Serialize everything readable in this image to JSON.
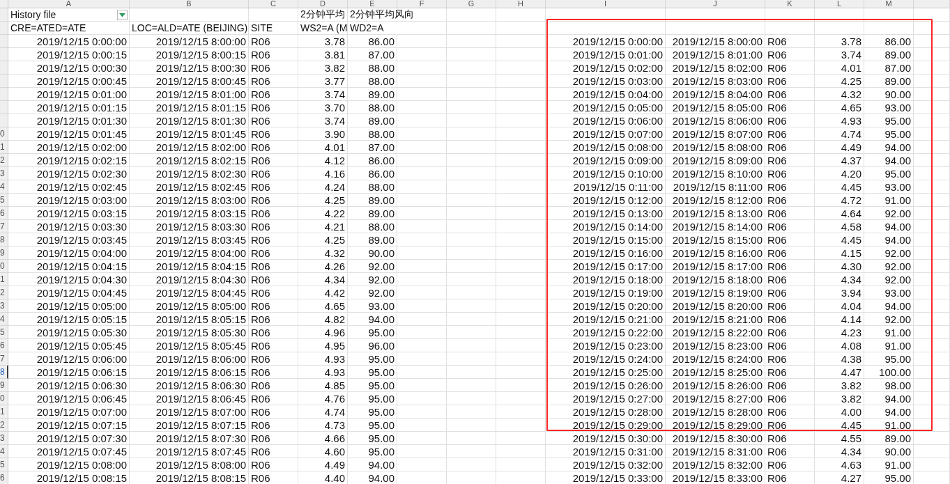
{
  "column_headers": [
    "A",
    "B",
    "C",
    "D",
    "E",
    "F",
    "G",
    "H",
    "I",
    "J",
    "K",
    "L",
    "M"
  ],
  "rows": [
    {
      "kind": "header",
      "selected": false,
      "highlighted": false,
      "filter": true,
      "cells": {
        "A": "History file",
        "D": "2分钟平均",
        "E": "2分钟平均风向"
      }
    },
    {
      "kind": "header",
      "selected": false,
      "highlighted": true,
      "cells": {
        "A": "CRE=ATED=ATE",
        "B": "LOC=ALD=ATE (BEIJING)",
        "C": "SITE",
        "D": "WS2=A (M",
        "E": "WD2=A"
      }
    },
    {
      "kind": "data",
      "selected": false,
      "highlighted": true,
      "cells": {
        "A": "2019/12/15 0:00:00",
        "B": "2019/12/15 8:00:00",
        "C": "R06",
        "D": "3.78",
        "E": "86.00",
        "I": "2019/12/15 0:00:00",
        "J": "2019/12/15 8:00:00",
        "K": "R06",
        "L": "3.78",
        "M": "86.00"
      }
    },
    {
      "kind": "data",
      "selected": false,
      "highlighted": true,
      "cells": {
        "A": "2019/12/15 0:00:15",
        "B": "2019/12/15 8:00:15",
        "C": "R06",
        "D": "3.81",
        "E": "87.00",
        "I": "2019/12/15 0:01:00",
        "J": "2019/12/15 8:01:00",
        "K": "R06",
        "L": "3.74",
        "M": "89.00"
      }
    },
    {
      "kind": "data",
      "selected": false,
      "highlighted": true,
      "cells": {
        "A": "2019/12/15 0:00:30",
        "B": "2019/12/15 8:00:30",
        "C": "R06",
        "D": "3.82",
        "E": "88.00",
        "I": "2019/12/15 0:02:00",
        "J": "2019/12/15 8:02:00",
        "K": "R06",
        "L": "4.01",
        "M": "87.00"
      }
    },
    {
      "kind": "data",
      "selected": false,
      "highlighted": true,
      "cells": {
        "A": "2019/12/15 0:00:45",
        "B": "2019/12/15 8:00:45",
        "C": "R06",
        "D": "3.77",
        "E": "88.00",
        "I": "2019/12/15 0:03:00",
        "J": "2019/12/15 8:03:00",
        "K": "R06",
        "L": "4.25",
        "M": "89.00"
      }
    },
    {
      "kind": "data",
      "selected": false,
      "highlighted": true,
      "cells": {
        "A": "2019/12/15 0:01:00",
        "B": "2019/12/15 8:01:00",
        "C": "R06",
        "D": "3.74",
        "E": "89.00",
        "I": "2019/12/15 0:04:00",
        "J": "2019/12/15 8:04:00",
        "K": "R06",
        "L": "4.32",
        "M": "90.00"
      }
    },
    {
      "kind": "data",
      "selected": false,
      "highlighted": true,
      "cells": {
        "A": "2019/12/15 0:01:15",
        "B": "2019/12/15 8:01:15",
        "C": "R06",
        "D": "3.70",
        "E": "88.00",
        "I": "2019/12/15 0:05:00",
        "J": "2019/12/15 8:05:00",
        "K": "R06",
        "L": "4.65",
        "M": "93.00"
      }
    },
    {
      "kind": "data",
      "selected": false,
      "highlighted": true,
      "cells": {
        "A": "2019/12/15 0:01:30",
        "B": "2019/12/15 8:01:30",
        "C": "R06",
        "D": "3.74",
        "E": "89.00",
        "I": "2019/12/15 0:06:00",
        "J": "2019/12/15 8:06:00",
        "K": "R06",
        "L": "4.93",
        "M": "95.00"
      }
    },
    {
      "kind": "data",
      "row_number": "0",
      "selected": false,
      "highlighted": true,
      "cells": {
        "A": "2019/12/15 0:01:45",
        "B": "2019/12/15 8:01:45",
        "C": "R06",
        "D": "3.90",
        "E": "88.00",
        "I": "2019/12/15 0:07:00",
        "J": "2019/12/15 8:07:00",
        "K": "R06",
        "L": "4.74",
        "M": "95.00"
      }
    },
    {
      "kind": "data",
      "row_number": "1",
      "selected": false,
      "highlighted": true,
      "cells": {
        "A": "2019/12/15 0:02:00",
        "B": "2019/12/15 8:02:00",
        "C": "R06",
        "D": "4.01",
        "E": "87.00",
        "I": "2019/12/15 0:08:00",
        "J": "2019/12/15 8:08:00",
        "K": "R06",
        "L": "4.49",
        "M": "94.00"
      }
    },
    {
      "kind": "data",
      "row_number": "2",
      "selected": false,
      "highlighted": true,
      "cells": {
        "A": "2019/12/15 0:02:15",
        "B": "2019/12/15 8:02:15",
        "C": "R06",
        "D": "4.12",
        "E": "86.00",
        "I": "2019/12/15 0:09:00",
        "J": "2019/12/15 8:09:00",
        "K": "R06",
        "L": "4.37",
        "M": "94.00"
      }
    },
    {
      "kind": "data",
      "row_number": "3",
      "selected": false,
      "highlighted": true,
      "cells": {
        "A": "2019/12/15 0:02:30",
        "B": "2019/12/15 8:02:30",
        "C": "R06",
        "D": "4.16",
        "E": "86.00",
        "I": "2019/12/15 0:10:00",
        "J": "2019/12/15 8:10:00",
        "K": "R06",
        "L": "4.20",
        "M": "95.00"
      }
    },
    {
      "kind": "data",
      "row_number": "4",
      "selected": false,
      "highlighted": true,
      "cells": {
        "A": "2019/12/15 0:02:45",
        "B": "2019/12/15 8:02:45",
        "C": "R06",
        "D": "4.24",
        "E": "88.00",
        "I": "2019/12/15 0:11:00",
        "J": "2019/12/15 8:11:00",
        "K": "R06",
        "L": "4.45",
        "M": "93.00"
      }
    },
    {
      "kind": "data",
      "row_number": "5",
      "selected": false,
      "highlighted": true,
      "cells": {
        "A": "2019/12/15 0:03:00",
        "B": "2019/12/15 8:03:00",
        "C": "R06",
        "D": "4.25",
        "E": "89.00",
        "I": "2019/12/15 0:12:00",
        "J": "2019/12/15 8:12:00",
        "K": "R06",
        "L": "4.72",
        "M": "91.00"
      }
    },
    {
      "kind": "data",
      "row_number": "6",
      "selected": false,
      "highlighted": true,
      "cells": {
        "A": "2019/12/15 0:03:15",
        "B": "2019/12/15 8:03:15",
        "C": "R06",
        "D": "4.22",
        "E": "89.00",
        "I": "2019/12/15 0:13:00",
        "J": "2019/12/15 8:13:00",
        "K": "R06",
        "L": "4.64",
        "M": "92.00"
      }
    },
    {
      "kind": "data",
      "row_number": "7",
      "selected": false,
      "highlighted": true,
      "cells": {
        "A": "2019/12/15 0:03:30",
        "B": "2019/12/15 8:03:30",
        "C": "R06",
        "D": "4.21",
        "E": "88.00",
        "I": "2019/12/15 0:14:00",
        "J": "2019/12/15 8:14:00",
        "K": "R06",
        "L": "4.58",
        "M": "94.00"
      }
    },
    {
      "kind": "data",
      "row_number": "8",
      "selected": false,
      "highlighted": true,
      "cells": {
        "A": "2019/12/15 0:03:45",
        "B": "2019/12/15 8:03:45",
        "C": "R06",
        "D": "4.25",
        "E": "89.00",
        "I": "2019/12/15 0:15:00",
        "J": "2019/12/15 8:15:00",
        "K": "R06",
        "L": "4.45",
        "M": "94.00"
      }
    },
    {
      "kind": "data",
      "row_number": "9",
      "selected": false,
      "highlighted": true,
      "cells": {
        "A": "2019/12/15 0:04:00",
        "B": "2019/12/15 8:04:00",
        "C": "R06",
        "D": "4.32",
        "E": "90.00",
        "I": "2019/12/15 0:16:00",
        "J": "2019/12/15 8:16:00",
        "K": "R06",
        "L": "4.15",
        "M": "92.00"
      }
    },
    {
      "kind": "data",
      "row_number": "0",
      "selected": false,
      "highlighted": true,
      "cells": {
        "A": "2019/12/15 0:04:15",
        "B": "2019/12/15 8:04:15",
        "C": "R06",
        "D": "4.26",
        "E": "92.00",
        "I": "2019/12/15 0:17:00",
        "J": "2019/12/15 8:17:00",
        "K": "R06",
        "L": "4.30",
        "M": "92.00"
      }
    },
    {
      "kind": "data",
      "row_number": "1",
      "selected": false,
      "highlighted": true,
      "cells": {
        "A": "2019/12/15 0:04:30",
        "B": "2019/12/15 8:04:30",
        "C": "R06",
        "D": "4.34",
        "E": "92.00",
        "I": "2019/12/15 0:18:00",
        "J": "2019/12/15 8:18:00",
        "K": "R06",
        "L": "4.34",
        "M": "92.00"
      }
    },
    {
      "kind": "data",
      "row_number": "2",
      "selected": false,
      "highlighted": true,
      "cells": {
        "A": "2019/12/15 0:04:45",
        "B": "2019/12/15 8:04:45",
        "C": "R06",
        "D": "4.42",
        "E": "92.00",
        "I": "2019/12/15 0:19:00",
        "J": "2019/12/15 8:19:00",
        "K": "R06",
        "L": "3.94",
        "M": "93.00"
      }
    },
    {
      "kind": "data",
      "row_number": "3",
      "selected": false,
      "highlighted": true,
      "cells": {
        "A": "2019/12/15 0:05:00",
        "B": "2019/12/15 8:05:00",
        "C": "R06",
        "D": "4.65",
        "E": "93.00",
        "I": "2019/12/15 0:20:00",
        "J": "2019/12/15 8:20:00",
        "K": "R06",
        "L": "4.04",
        "M": "94.00"
      }
    },
    {
      "kind": "data",
      "row_number": "4",
      "selected": false,
      "highlighted": true,
      "cells": {
        "A": "2019/12/15 0:05:15",
        "B": "2019/12/15 8:05:15",
        "C": "R06",
        "D": "4.82",
        "E": "94.00",
        "I": "2019/12/15 0:21:00",
        "J": "2019/12/15 8:21:00",
        "K": "R06",
        "L": "4.14",
        "M": "92.00"
      }
    },
    {
      "kind": "data",
      "row_number": "5",
      "selected": false,
      "highlighted": true,
      "cells": {
        "A": "2019/12/15 0:05:30",
        "B": "2019/12/15 8:05:30",
        "C": "R06",
        "D": "4.96",
        "E": "95.00",
        "I": "2019/12/15 0:22:00",
        "J": "2019/12/15 8:22:00",
        "K": "R06",
        "L": "4.23",
        "M": "91.00"
      }
    },
    {
      "kind": "data",
      "row_number": "6",
      "selected": false,
      "highlighted": true,
      "cells": {
        "A": "2019/12/15 0:05:45",
        "B": "2019/12/15 8:05:45",
        "C": "R06",
        "D": "4.95",
        "E": "96.00",
        "I": "2019/12/15 0:23:00",
        "J": "2019/12/15 8:23:00",
        "K": "R06",
        "L": "4.08",
        "M": "91.00"
      }
    },
    {
      "kind": "data",
      "row_number": "7",
      "selected": false,
      "highlighted": true,
      "cells": {
        "A": "2019/12/15 0:06:00",
        "B": "2019/12/15 8:06:00",
        "C": "R06",
        "D": "4.93",
        "E": "95.00",
        "I": "2019/12/15 0:24:00",
        "J": "2019/12/15 8:24:00",
        "K": "R06",
        "L": "4.38",
        "M": "95.00"
      }
    },
    {
      "kind": "data",
      "row_number": "8",
      "selected": true,
      "highlighted": true,
      "cells": {
        "A": "2019/12/15 0:06:15",
        "B": "2019/12/15 8:06:15",
        "C": "R06",
        "D": "4.93",
        "E": "95.00",
        "I": "2019/12/15 0:25:00",
        "J": "2019/12/15 8:25:00",
        "K": "R06",
        "L": "4.47",
        "M": "100.00"
      }
    },
    {
      "kind": "data",
      "row_number": "9",
      "selected": false,
      "highlighted": true,
      "cells": {
        "A": "2019/12/15 0:06:30",
        "B": "2019/12/15 8:06:30",
        "C": "R06",
        "D": "4.85",
        "E": "95.00",
        "I": "2019/12/15 0:26:00",
        "J": "2019/12/15 8:26:00",
        "K": "R06",
        "L": "3.82",
        "M": "98.00"
      }
    },
    {
      "kind": "data",
      "row_number": "0",
      "selected": false,
      "highlighted": true,
      "cells": {
        "A": "2019/12/15 0:06:45",
        "B": "2019/12/15 8:06:45",
        "C": "R06",
        "D": "4.76",
        "E": "95.00",
        "I": "2019/12/15 0:27:00",
        "J": "2019/12/15 8:27:00",
        "K": "R06",
        "L": "3.82",
        "M": "94.00"
      }
    },
    {
      "kind": "data",
      "row_number": "1",
      "selected": false,
      "highlighted": true,
      "cells": {
        "A": "2019/12/15 0:07:00",
        "B": "2019/12/15 8:07:00",
        "C": "R06",
        "D": "4.74",
        "E": "95.00",
        "I": "2019/12/15 0:28:00",
        "J": "2019/12/15 8:28:00",
        "K": "R06",
        "L": "4.00",
        "M": "94.00"
      }
    },
    {
      "kind": "data",
      "row_number": "2",
      "selected": false,
      "highlighted": true,
      "cells": {
        "A": "2019/12/15 0:07:15",
        "B": "2019/12/15 8:07:15",
        "C": "R06",
        "D": "4.73",
        "E": "95.00",
        "I": "2019/12/15 0:29:00",
        "J": "2019/12/15 8:29:00",
        "K": "R06",
        "L": "4.45",
        "M": "91.00"
      }
    },
    {
      "kind": "data",
      "row_number": "3",
      "selected": false,
      "highlighted": false,
      "cells": {
        "A": "2019/12/15 0:07:30",
        "B": "2019/12/15 8:07:30",
        "C": "R06",
        "D": "4.66",
        "E": "95.00",
        "I": "2019/12/15 0:30:00",
        "J": "2019/12/15 8:30:00",
        "K": "R06",
        "L": "4.55",
        "M": "89.00"
      }
    },
    {
      "kind": "data",
      "row_number": "4",
      "selected": false,
      "highlighted": false,
      "cells": {
        "A": "2019/12/15 0:07:45",
        "B": "2019/12/15 8:07:45",
        "C": "R06",
        "D": "4.60",
        "E": "95.00",
        "I": "2019/12/15 0:31:00",
        "J": "2019/12/15 8:31:00",
        "K": "R06",
        "L": "4.34",
        "M": "90.00"
      }
    },
    {
      "kind": "data",
      "row_number": "5",
      "selected": false,
      "highlighted": false,
      "cells": {
        "A": "2019/12/15 0:08:00",
        "B": "2019/12/15 8:08:00",
        "C": "R06",
        "D": "4.49",
        "E": "94.00",
        "I": "2019/12/15 0:32:00",
        "J": "2019/12/15 8:32:00",
        "K": "R06",
        "L": "4.63",
        "M": "91.00"
      }
    },
    {
      "kind": "data",
      "row_number": "6",
      "selected": false,
      "highlighted": false,
      "cells": {
        "A": "2019/12/15 0:08:15",
        "B": "2019/12/15 8:08:15",
        "C": "R06",
        "D": "4.40",
        "E": "94.00",
        "I": "2019/12/15 0:33:00",
        "J": "2019/12/15 8:33:00",
        "K": "R06",
        "L": "4.27",
        "M": "95.00"
      }
    }
  ]
}
